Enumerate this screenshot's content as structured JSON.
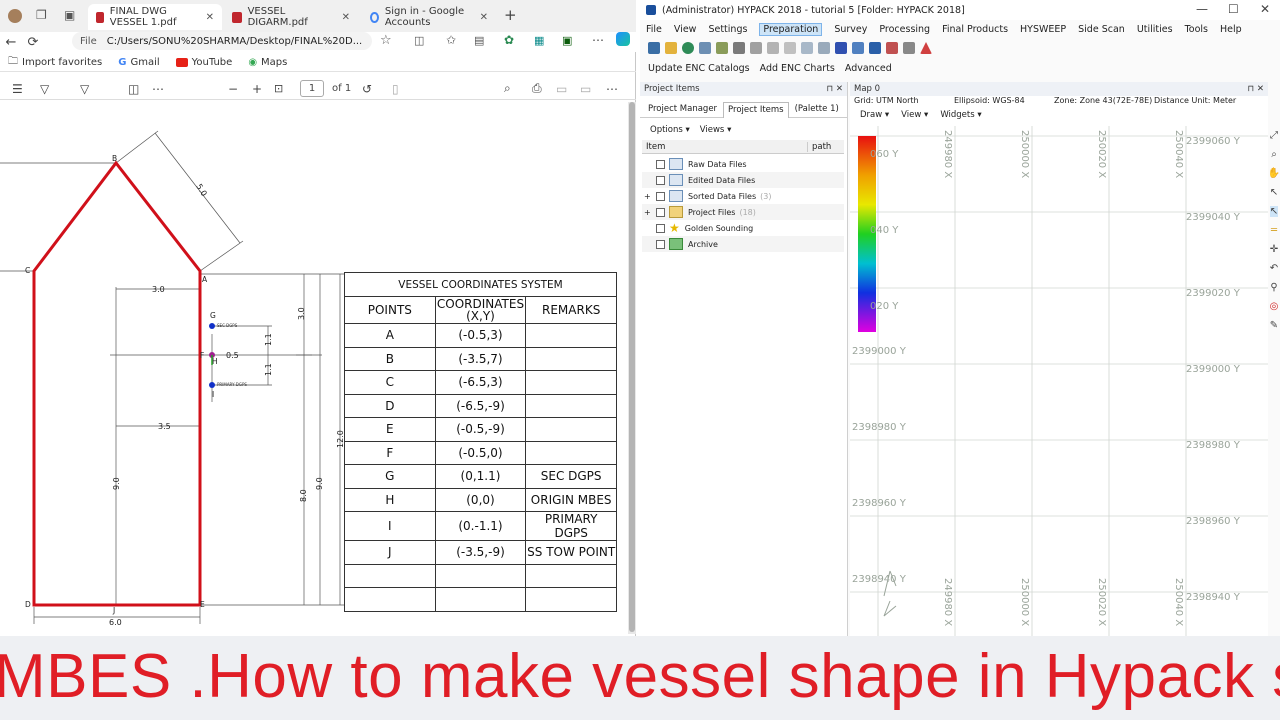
{
  "browser": {
    "tabs": [
      {
        "label": "FINAL DWG VESSEL 1.pdf",
        "icon": "pdf-icon",
        "active": true
      },
      {
        "label": "VESSEL DIGARM.pdf",
        "icon": "pdf-icon",
        "active": false
      },
      {
        "label": "Sign in - Google Accounts",
        "icon": "google-icon",
        "active": false
      }
    ],
    "address": {
      "scheme": "File",
      "url": "C:/Users/SONU%20SHARMA/Desktop/FINAL%20D..."
    },
    "favorites": [
      "Import favorites",
      "Gmail",
      "YouTube",
      "Maps"
    ],
    "pdf_toolbar": {
      "page_current": "1",
      "page_total": "of 1"
    }
  },
  "drawing": {
    "table_title": "VESSEL COORDINATES SYSTEM",
    "headers": [
      "POINTS",
      "COORDINATES\n(X,Y)",
      "REMARKS"
    ],
    "rows": [
      [
        "A",
        "(-0.5,3)",
        ""
      ],
      [
        "B",
        "(-3.5,7)",
        ""
      ],
      [
        "C",
        "(-6.5,3)",
        ""
      ],
      [
        "D",
        "(-6.5,-9)",
        ""
      ],
      [
        "E",
        "(-0.5,-9)",
        ""
      ],
      [
        "F",
        "(-0.5,0)",
        ""
      ],
      [
        "G",
        "(0,1.1)",
        "SEC DGPS"
      ],
      [
        "H",
        "(0,0)",
        "ORIGIN MBES"
      ],
      [
        "I",
        "(0.-1.1)",
        "PRIMARY DGPS"
      ],
      [
        "J",
        "(-3.5,-9)",
        "SS TOW POINT"
      ],
      [
        "",
        "",
        ""
      ],
      [
        "",
        "",
        ""
      ]
    ],
    "point_labels": {
      "A": "A",
      "B": "B",
      "C": "C",
      "D": "D",
      "E": "E",
      "F": "F",
      "G": "G",
      "H": "H",
      "I": "I",
      "J": "J"
    },
    "dims": {
      "d50": "5.0",
      "d30a": "3.0",
      "d30b": "3.0",
      "d05": "0.5",
      "d11a": "1.1",
      "d11b": "1.1",
      "d35": "3.5",
      "d90a": "9.0",
      "d80": "8.0",
      "d90b": "9.0",
      "d120": "12.0",
      "d60": "6.0"
    },
    "marker_labels": {
      "sec": "SEC DGPS",
      "primary": "PRIMARY DGPS"
    }
  },
  "hypack": {
    "title": "(Administrator) HYPACK 2018 - tutorial 5  [Folder: HYPACK 2018]",
    "menu": [
      "File",
      "View",
      "Settings",
      "Preparation",
      "Survey",
      "Processing",
      "Final Products",
      "HYSWEEP",
      "Side Scan",
      "Utilities",
      "Tools",
      "Help"
    ],
    "selected_menu": "Preparation",
    "subtoolbar": [
      "Update ENC Catalogs",
      "Add ENC Charts",
      "Advanced"
    ],
    "project_panel": {
      "title": "Project Items",
      "tabs": [
        "Project Manager",
        "Project Items",
        "(Palette 1)"
      ],
      "options": [
        "Options",
        "Views"
      ],
      "columns": [
        "Item",
        "path"
      ],
      "items": [
        {
          "label": "Raw Data Files",
          "count": ""
        },
        {
          "label": "Edited Data Files",
          "count": ""
        },
        {
          "label": "Sorted Data Files",
          "count": "(3)"
        },
        {
          "label": "Project Files",
          "count": "(18)"
        },
        {
          "label": "Golden Sounding",
          "count": ""
        },
        {
          "label": "Archive",
          "count": ""
        }
      ]
    },
    "map": {
      "title": "Map 0",
      "info": [
        "Grid: UTM North",
        "Ellipsoid: WGS-84",
        "Zone: Zone 43(72E-78E)",
        "Distance Unit: Meter"
      ],
      "menu": [
        "Draw",
        "View",
        "Widgets"
      ],
      "x_labels": [
        "249980 X",
        "250000 X",
        "250020 X",
        "250040 X"
      ],
      "y_labels": [
        "2399060 Y",
        "2399040 Y",
        "2399020 Y",
        "2399000 Y",
        "2398980 Y",
        "2398960 Y",
        "2398940 Y"
      ],
      "scale_labels": [
        "060 Y",
        "040 Y",
        "020 Y"
      ]
    }
  },
  "caption": "MBES .How to make vessel shape in Hypack softw"
}
